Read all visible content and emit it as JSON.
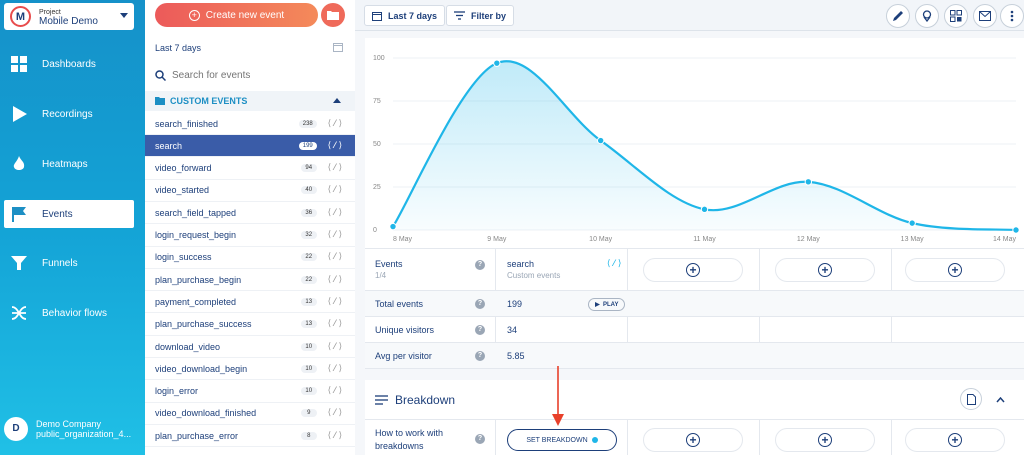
{
  "nav": {
    "project": {
      "label": "Project",
      "name": "Mobile Demo",
      "initial": "M"
    },
    "items": [
      {
        "label": "Dashboards",
        "icon": "grid-icon"
      },
      {
        "label": "Recordings",
        "icon": "play-icon"
      },
      {
        "label": "Heatmaps",
        "icon": "flame-icon"
      },
      {
        "label": "Events",
        "icon": "flag-icon",
        "active": true
      },
      {
        "label": "Funnels",
        "icon": "funnel-icon"
      },
      {
        "label": "Behavior flows",
        "icon": "flows-icon"
      }
    ],
    "company": {
      "initial": "D",
      "name": "Demo Company",
      "org": "public_organization_4..."
    }
  },
  "events_panel": {
    "create_label": "Create new event",
    "range_label": "Last 7 days",
    "search_placeholder": "Search for events",
    "section_label": "CUSTOM EVENTS",
    "events": [
      {
        "name": "search_finished",
        "count": "238"
      },
      {
        "name": "search",
        "count": "199",
        "selected": true
      },
      {
        "name": "video_forward",
        "count": "94"
      },
      {
        "name": "video_started",
        "count": "40"
      },
      {
        "name": "search_field_tapped",
        "count": "36"
      },
      {
        "name": "login_request_begin",
        "count": "32"
      },
      {
        "name": "login_success",
        "count": "22"
      },
      {
        "name": "plan_purchase_begin",
        "count": "22"
      },
      {
        "name": "payment_completed",
        "count": "13"
      },
      {
        "name": "plan_purchase_success",
        "count": "13"
      },
      {
        "name": "download_video",
        "count": "10"
      },
      {
        "name": "video_download_begin",
        "count": "10"
      },
      {
        "name": "login_error",
        "count": "10"
      },
      {
        "name": "video_download_finished",
        "count": "9"
      },
      {
        "name": "plan_purchase_error",
        "count": "8"
      }
    ],
    "code_glyph": "⟨/⟩"
  },
  "toolbar": {
    "range": "Last 7 days",
    "filter": "Filter by"
  },
  "chart_data": {
    "type": "area",
    "x": [
      "8 May",
      "9 May",
      "10 May",
      "11 May",
      "12 May",
      "13 May",
      "14 May"
    ],
    "series": [
      {
        "values": [
          2,
          97,
          52,
          12,
          28,
          4,
          0
        ]
      }
    ],
    "yticks": [
      0,
      25,
      50,
      75,
      100
    ],
    "ylim": [
      0,
      100
    ],
    "color": "#1fb6e8"
  },
  "table": {
    "events_label": "Events",
    "events_sub": "1/4",
    "event_name": "search",
    "event_type": "Custom events",
    "code_glyph": "⟨/⟩",
    "rows": [
      {
        "label": "Total events",
        "value": "199"
      },
      {
        "label": "Unique visitors",
        "value": "34"
      },
      {
        "label": "Avg per visitor",
        "value": "5.85"
      }
    ],
    "play_label": "PLAY",
    "help_glyph": "?"
  },
  "breakdown": {
    "title": "Breakdown",
    "how_to_line1": "How to work with",
    "how_to_line2": "breakdowns",
    "set_label": "SET BREAKDOWN"
  },
  "colors": {
    "accent": "#1fb6e8",
    "navy": "#1d3f7a",
    "annotation": "#e8402a"
  }
}
